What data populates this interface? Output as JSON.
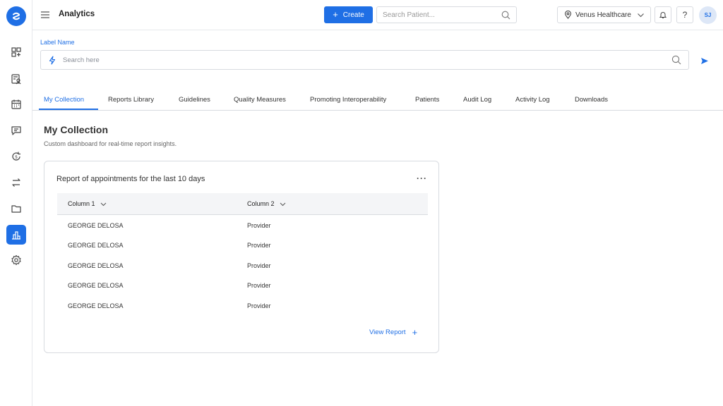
{
  "header": {
    "title": "Analytics",
    "create_label": "Create",
    "search_placeholder": "Search Patient...",
    "facility": "Venus Healthcare",
    "help_label": "?",
    "avatar_initials": "SJ"
  },
  "sidebar": {
    "items": [
      {
        "name": "dashboard-icon"
      },
      {
        "name": "patients-icon"
      },
      {
        "name": "calendar-icon"
      },
      {
        "name": "messages-icon"
      },
      {
        "name": "billing-icon"
      },
      {
        "name": "transfer-icon"
      },
      {
        "name": "folder-icon"
      },
      {
        "name": "analytics-icon",
        "active": true
      },
      {
        "name": "settings-icon"
      }
    ]
  },
  "label_search": {
    "label": "Label Name",
    "placeholder": "Search here"
  },
  "tabs": [
    {
      "label": "My Collection",
      "active": true
    },
    {
      "label": "Reports Library"
    },
    {
      "label": "Guidelines"
    },
    {
      "label": "Quality Measures"
    },
    {
      "label": "Promoting Interoperability"
    },
    {
      "label": "Patients"
    },
    {
      "label": "Audit Log"
    },
    {
      "label": "Activity Log"
    },
    {
      "label": "Downloads"
    }
  ],
  "main": {
    "title": "My Collection",
    "subtitle": "Custom dashboard for real-time report insights."
  },
  "card": {
    "title": "Report of appointments for the last 10 days",
    "more_label": "···",
    "columns": [
      "Column 1",
      "Column 2"
    ],
    "rows": [
      [
        "GEORGE DELOSA",
        "Provider"
      ],
      [
        "GEORGE DELOSA",
        "Provider"
      ],
      [
        "GEORGE DELOSA",
        "Provider"
      ],
      [
        "GEORGE DELOSA",
        "Provider"
      ],
      [
        "GEORGE DELOSA",
        "Provider"
      ]
    ],
    "view_report_label": "View Report"
  },
  "colors": {
    "accent": "#1f6fe5",
    "border": "#d8dbe0"
  }
}
